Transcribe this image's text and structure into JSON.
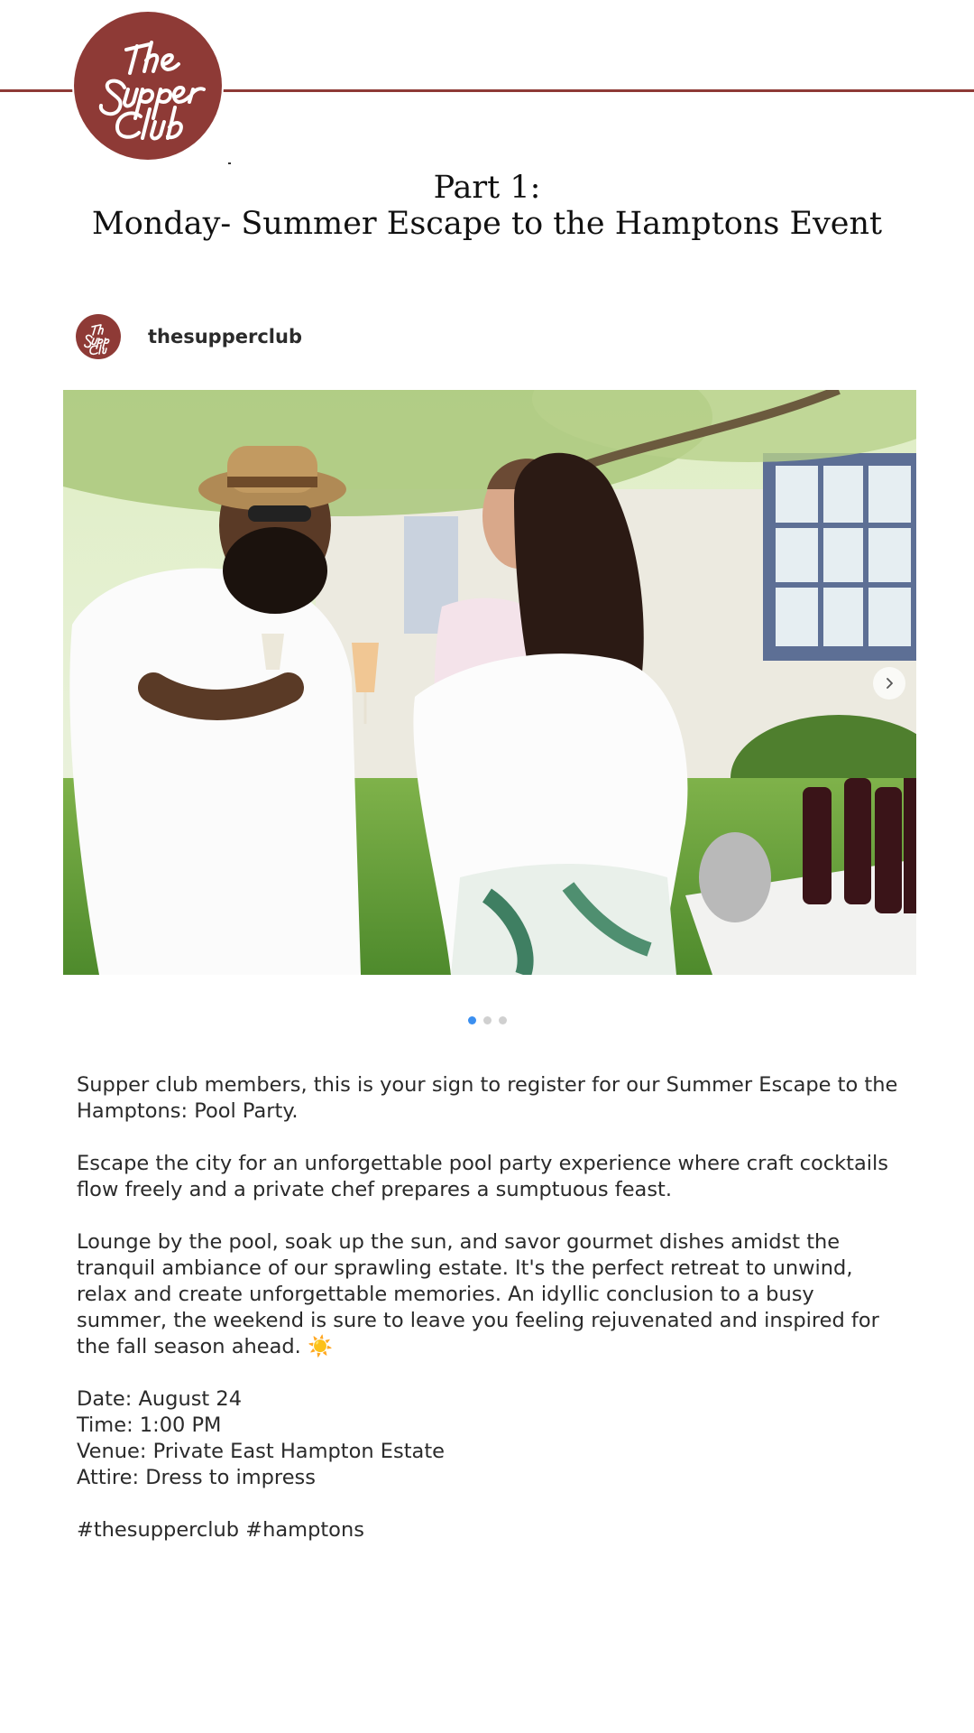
{
  "header": {
    "logo_text": "The Supper Club",
    "brand_color": "#8e3a36"
  },
  "title": {
    "line1": "Part 1:",
    "line2": "Monday- Summer Escape to the Hamptons Event"
  },
  "post": {
    "username": "thesupperclub",
    "avatar_icon": "supper-club-logo-icon",
    "carousel": {
      "slide_count": 3,
      "active_index": 0,
      "next_icon": "chevron-right-icon",
      "active_dot_color": "#3b8ff0"
    },
    "caption": {
      "p1": "Supper club members, this is your sign to register for our Summer Escape to the Hamptons: Pool Party.",
      "p2": "Escape the city for an unforgettable pool party experience where craft cocktails flow freely and a private chef prepares a sumptuous feast.",
      "p3": "Lounge by the pool, soak up the sun, and savor gourmet dishes amidst the tranquil ambiance of our sprawling estate. It's the perfect retreat to unwind, relax and create unforgettable memories. An idyllic conclusion to a busy summer, the weekend is sure to leave you feeling rejuvenated and inspired for the fall season ahead.",
      "p3_emoji": "☀️",
      "date": "Date: August 24",
      "time": "Time: 1:00 PM",
      "venue": "Venue: Private East Hampton Estate",
      "attire": "Attire: Dress to impress",
      "hashtag1": "#thesupperclub",
      "hashtag2": "#hamptons"
    }
  }
}
